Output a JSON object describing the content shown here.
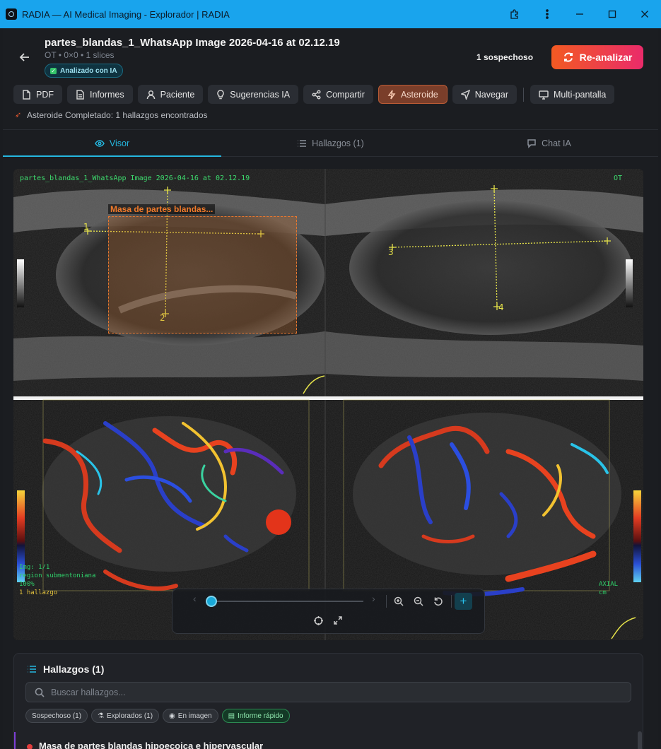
{
  "window": {
    "title": "RADIA — AI Medical Imaging - Explorador | RADIA"
  },
  "header": {
    "file_title": "partes_blandas_1_WhatsApp Image 2026-04-16 at 02.12.19",
    "file_meta": "OT • 0×0 • 1 slices",
    "ai_badge": "Analizado con IA",
    "suspect_count": "1 sospechoso",
    "reanalyze_label": "Re-analizar"
  },
  "toolbar": {
    "pdf": "PDF",
    "informes": "Informes",
    "paciente": "Paciente",
    "sugerencias": "Sugerencias IA",
    "compartir": "Compartir",
    "asteroide": "Asteroide",
    "navegar": "Navegar",
    "multipantalla": "Multi-pantalla"
  },
  "status_line": "Asteroide Completado: 1 hallazgos encontrados",
  "tabs": {
    "visor": "Visor",
    "hallazgos": "Hallazgos (1)",
    "chat": "Chat IA"
  },
  "viewer": {
    "overlay_filename": "partes_blandas_1_WhatsApp Image 2026-04-16 at 02.12.19",
    "overlay_modality": "OT",
    "finding_label": "Masa de partes blandas...",
    "info_img": "Img: 1/1",
    "info_region": "region submentoniana",
    "info_zoom": "100%",
    "info_hallazgo": "1 hallazgo",
    "axial_label": "AXIAL",
    "axial_cm": "cm"
  },
  "findings_panel": {
    "title": "Hallazgos (1)",
    "search_placeholder": "Buscar hallazgos...",
    "chips": {
      "sospechoso": "Sospechoso (1)",
      "explorados": "Explorados (1)",
      "en_imagen": "En imagen",
      "informe_rapido": "Informe rápido"
    },
    "first_finding": "Masa de partes blandas hipoecoica e hipervascular"
  },
  "colors": {
    "accent": "#25b7e0",
    "titlebar": "#19a4ed",
    "reanalyze_start": "#f25a22",
    "reanalyze_end": "#ea2b6a",
    "finding_orange": "#e8772e"
  },
  "icons": {
    "back": "arrow-left-icon",
    "reanalyze": "refresh-icon",
    "pdf": "file-icon",
    "informes": "document-icon",
    "paciente": "user-icon",
    "sugerencias": "lightbulb-icon",
    "compartir": "share-icon",
    "asteroide": "lightning-icon",
    "navegar": "navigation-icon",
    "multipantalla": "monitor-icon",
    "visor": "eye-icon",
    "hallazgos": "list-icon",
    "chat": "chat-icon"
  }
}
